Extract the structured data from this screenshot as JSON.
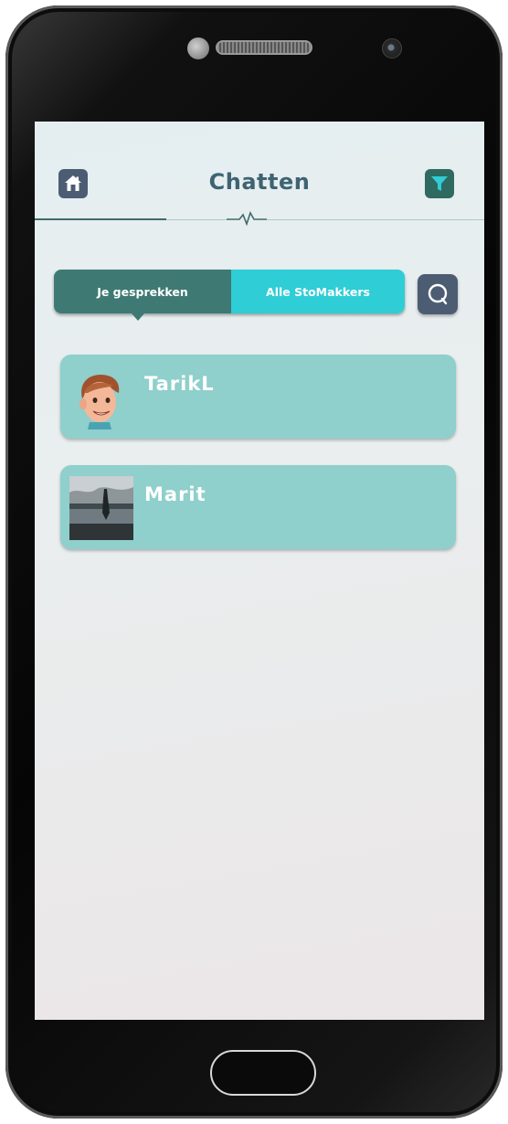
{
  "header": {
    "title": "Chatten"
  },
  "tabs": {
    "conversations_label": "Je gesprekken",
    "all_buddies_label": "Alle StoMakkers",
    "active": "conversations"
  },
  "contacts": [
    {
      "name": "TarikL",
      "avatar": "cartoon-man-avatar"
    },
    {
      "name": "Marit",
      "avatar": "lake-photo-avatar"
    }
  ],
  "icons": {
    "home": "home-icon",
    "filter": "filter-icon",
    "search": "search-icon",
    "pulse": "heartbeat-icon"
  },
  "colors": {
    "header_title": "#3e6473",
    "home_button": "#4c5d73",
    "filter_button": "#2f6a61",
    "filter_funnel": "#2fcdd6",
    "tab_active": "#3e7a73",
    "tab_inactive": "#2fcdd6",
    "card_background": "#8fcfcc"
  }
}
